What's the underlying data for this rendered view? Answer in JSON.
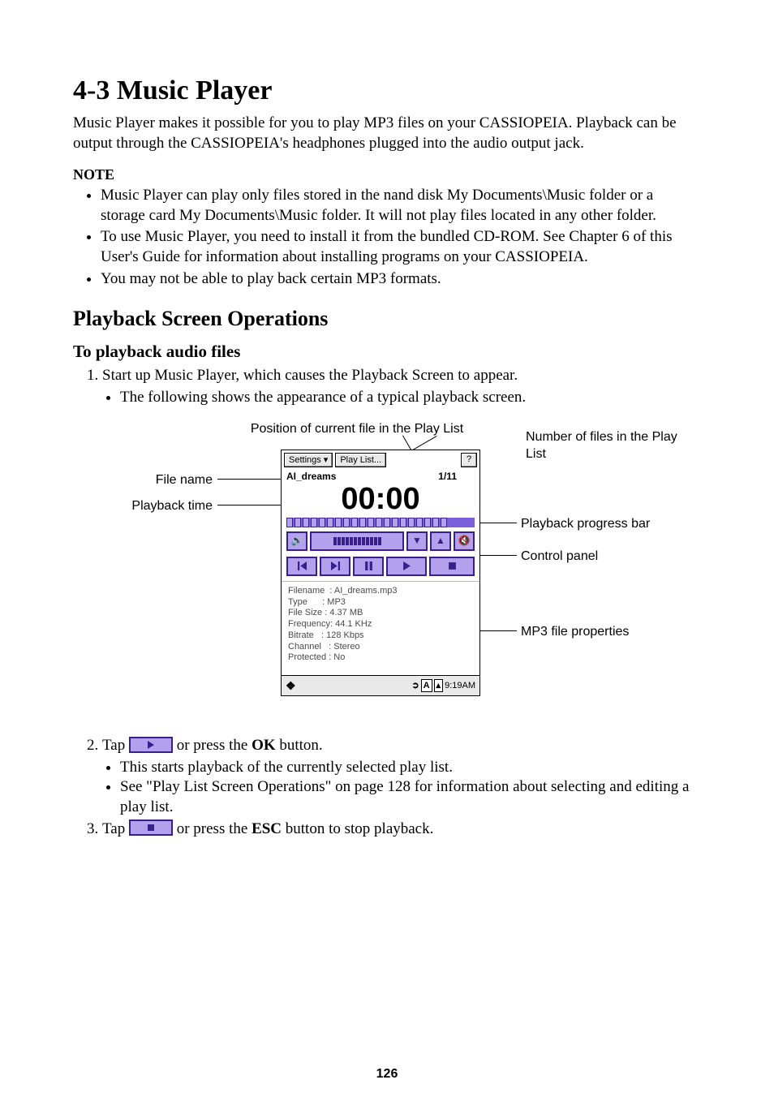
{
  "title": "4-3 Music Player",
  "intro": "Music Player makes it possible for you to play MP3 files on your CASSIOPEIA. Playback can be output through the CASSIOPEIA's headphones plugged into the audio output jack.",
  "note_heading": "NOTE",
  "notes": [
    "Music Player can play only files stored in the nand disk My Documents\\Music folder or a storage card My Documents\\Music folder. It will not play files located in any other folder.",
    "To use Music Player, you need to install it from the bundled CD-ROM. See Chapter 6 of this User's Guide for information about installing programs on your CASSIOPEIA.",
    "You may not be able to play back certain MP3 formats."
  ],
  "h2": "Playback Screen Operations",
  "h3": "To playback audio files",
  "step1": "Start up Music Player, which causes the Playback Screen to appear.",
  "step1_sub": "The following shows the appearance of a typical playback screen.",
  "callouts": {
    "position": "Position of current file in the Play List",
    "num_files": "Number of files in the Play List",
    "filename": "File name",
    "time": "Playback time",
    "progress": "Playback progress bar",
    "panel": "Control panel",
    "props": "MP3 file properties"
  },
  "player": {
    "settings": "Settings",
    "playlist": "Play List...",
    "filename": "AI_dreams",
    "counter": "1/11",
    "time": "00:00",
    "props": {
      "Filename": "AI_dreams.mp3",
      "Type": "MP3",
      "File Size": "4.37 MB",
      "Frequency": "44.1 KHz",
      "Bitrate": "128 Kbps",
      "Channel": "Stereo",
      "Protected": "No"
    },
    "clock": "9:19AM"
  },
  "step2_pre": "Tap ",
  "step2_post": " or press the ",
  "step2_btn": "OK",
  "step2_end": " button.",
  "step2_subs": [
    "This starts playback of the currently selected play list.",
    "See \"Play List Screen Operations\" on page 128 for information about selecting and editing a play list."
  ],
  "step3_pre": "Tap ",
  "step3_post": " or press the ",
  "step3_btn": "ESC",
  "step3_end": " button to stop playback.",
  "page_number": "126"
}
